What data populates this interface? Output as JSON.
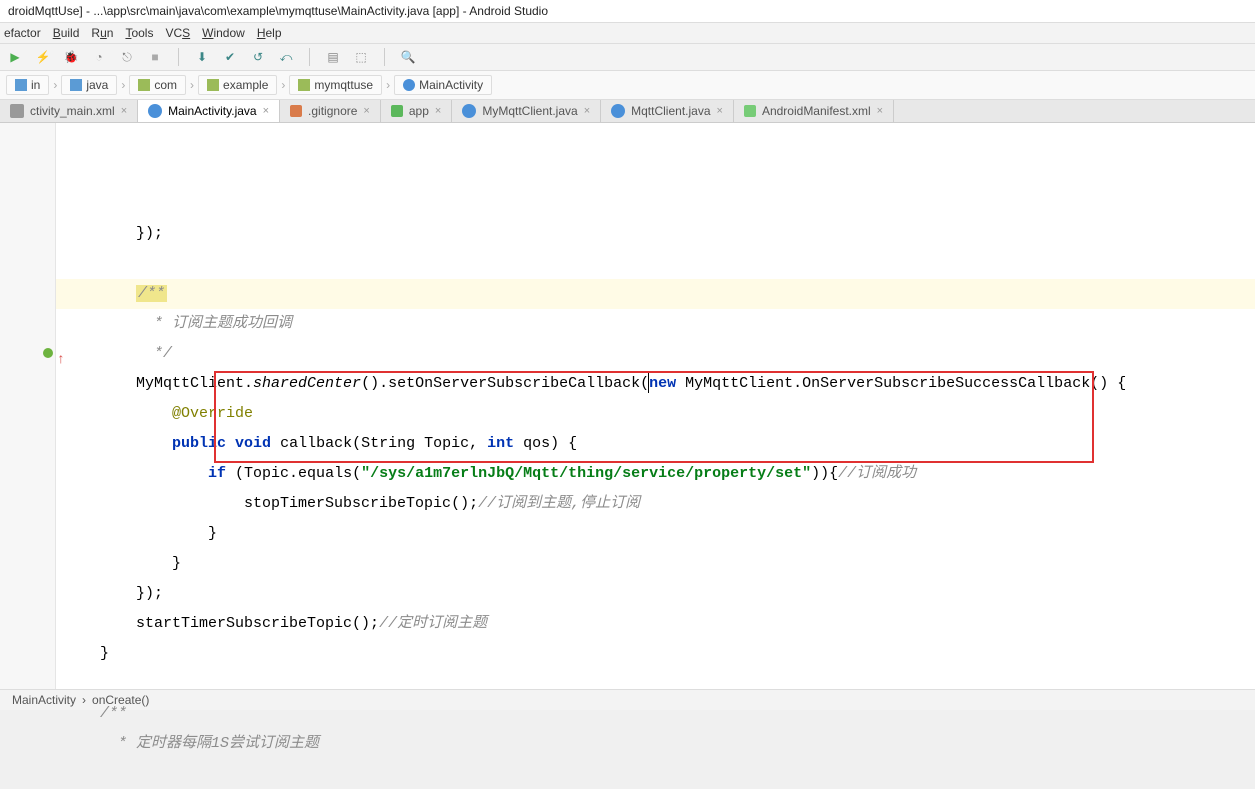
{
  "title": "droidMqttUse] - ...\\app\\src\\main\\java\\com\\example\\mymqttuse\\MainActivity.java [app] - Android Studio",
  "menu": [
    "efactor",
    "Build",
    "Run",
    "Tools",
    "VCS",
    "Window",
    "Help"
  ],
  "crumbs": [
    {
      "icon": "folder-blue",
      "label": "in"
    },
    {
      "icon": "folder-blue",
      "label": "java"
    },
    {
      "icon": "folder-green",
      "label": "com"
    },
    {
      "icon": "folder-green",
      "label": "example"
    },
    {
      "icon": "folder-green",
      "label": "mymqttuse"
    },
    {
      "icon": "class",
      "label": "MainActivity"
    }
  ],
  "tabs": [
    {
      "icon": "xml",
      "label": "ctivity_main.xml",
      "active": false
    },
    {
      "icon": "java",
      "label": "MainActivity.java",
      "active": true
    },
    {
      "icon": "git",
      "label": ".gitignore",
      "active": false
    },
    {
      "icon": "mod",
      "label": "app",
      "active": false
    },
    {
      "icon": "java",
      "label": "MyMqttClient.java",
      "active": false
    },
    {
      "icon": "java",
      "label": "MqttClient.java",
      "active": false
    },
    {
      "icon": "mf",
      "label": "AndroidManifest.xml",
      "active": false
    }
  ],
  "code": {
    "l1": "        });",
    "l2": "",
    "l3a": "        ",
    "l3b": "/**",
    "l4": "          * 订阅主题成功回调",
    "l5": "          */",
    "l6a": "        MyMqttClient.",
    "l6b": "sharedCenter",
    "l6c": "().setOnServerSubscribeCallback(",
    "l6d": "new",
    "l6e": " MyMqttClient.OnServerSubscribeSuccessCallback() {",
    "l7": "            @Override",
    "l8a": "            ",
    "l8b": "public void",
    "l8c": " callback(String Topic, ",
    "l8d": "int",
    "l8e": " qos) {",
    "l9a": "                ",
    "l9b": "if",
    "l9c": " (Topic.equals(",
    "l9d": "\"/sys/a1m7erlnJbQ/Mqtt/thing/service/property/set\"",
    "l9e": ")){",
    "l9f": "//订阅成功",
    "l10a": "                    stopTimerSubscribeTopic();",
    "l10b": "//订阅到主题,停止订阅",
    "l11": "                }",
    "l12": "            }",
    "l13": "        });",
    "l14a": "        startTimerSubscribeTopic();",
    "l14b": "//定时订阅主题",
    "l15": "    }",
    "l16": "",
    "l17": "    /**",
    "l18": "      * 定时器每隔1S尝试订阅主题"
  },
  "status": {
    "a": "MainActivity",
    "sep": "›",
    "b": "onCreate()"
  }
}
